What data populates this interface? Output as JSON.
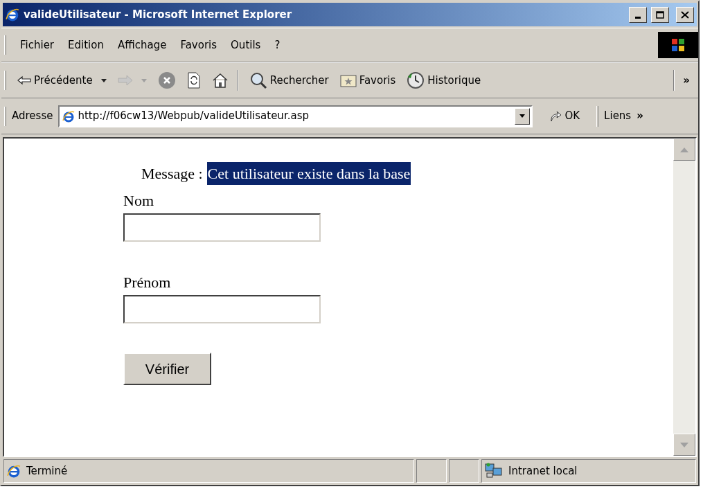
{
  "window": {
    "title": "valideUtilisateur - Microsoft Internet Explorer"
  },
  "menu": [
    "Fichier",
    "Edition",
    "Affichage",
    "Favoris",
    "Outils",
    "?"
  ],
  "toolbar": {
    "buttons": [
      {
        "kind": "back",
        "label": "Précédente",
        "disabled": false
      },
      {
        "kind": "forward",
        "disabled": true
      },
      {
        "kind": "stop"
      },
      {
        "kind": "refresh"
      },
      {
        "kind": "home"
      },
      {
        "kind": "search",
        "label": "Rechercher"
      },
      {
        "kind": "favorites",
        "label": "Favoris"
      },
      {
        "kind": "history",
        "label": "Historique"
      }
    ],
    "overflow": "»"
  },
  "address": {
    "label": "Adresse",
    "url": "http://f06cw13/Webpub/valideUtilisateur.asp",
    "go": "OK",
    "links": "Liens",
    "links_overflow": "»"
  },
  "page": {
    "message_label": "Message :",
    "message": "Cet utilisateur existe dans la base",
    "message_selected": true,
    "fields": [
      {
        "label": "Nom"
      },
      {
        "label": "Prénom"
      }
    ],
    "submit": "Vérifier"
  },
  "status_bar": {
    "text": "Terminé",
    "zone": "Intranet local"
  }
}
